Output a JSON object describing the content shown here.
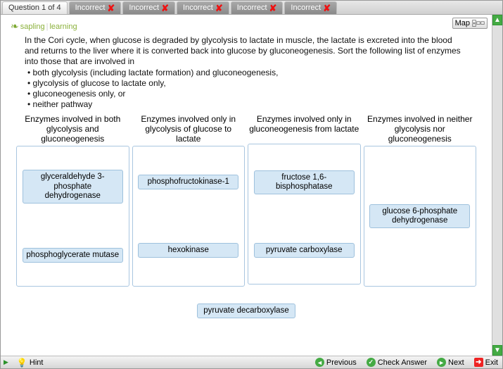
{
  "tabs": {
    "active": "Question 1 of 4",
    "inactive_label": "Incorrect",
    "inactive_count": 5
  },
  "logo": {
    "brand1": "sapling",
    "brand2": "learning"
  },
  "map_button": "Map",
  "question": {
    "intro": "In the Cori cycle, when glucose is degraded by glycolysis to lactate in muscle, the lactate is excreted into the blood and returns to the liver where it is converted back into glucose by gluconeogenesis. Sort the following list of enzymes into those that are involved in",
    "bullets": [
      "both glycolysis (including lactate formation) and gluconeogenesis,",
      "glycolysis of glucose to lactate only,",
      "gluconeogenesis only, or",
      "neither pathway"
    ]
  },
  "columns": [
    {
      "header": "Enzymes involved in both glycolysis and gluconeogenesis",
      "items": [
        "glyceraldehyde 3-phosphate dehydrogenase",
        "phosphoglycerate mutase"
      ]
    },
    {
      "header": "Enzymes involved only in glycolysis of glucose to lactate",
      "items": [
        "phosphofructokinase-1",
        "hexokinase"
      ]
    },
    {
      "header": "Enzymes involved only in gluconeogenesis from lactate",
      "items": [
        "fructose 1,6-bisphosphatase",
        "pyruvate carboxylase"
      ]
    },
    {
      "header": "Enzymes involved in neither glycolysis nor gluconeogenesis",
      "items": [
        "glucose 6-phosphate dehydrogenase"
      ]
    }
  ],
  "pool": [
    "pyruvate decarboxylase"
  ],
  "footer": {
    "hint": "Hint",
    "previous": "Previous",
    "check": "Check Answer",
    "next": "Next",
    "exit": "Exit"
  }
}
